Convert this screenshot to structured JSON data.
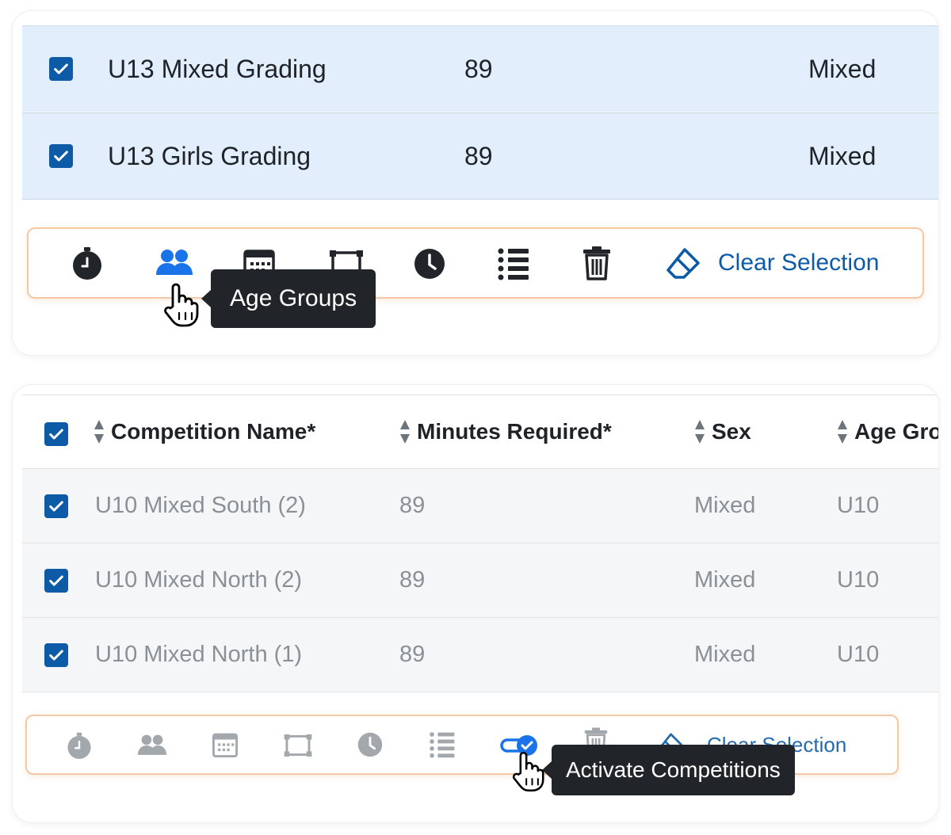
{
  "panel1": {
    "rows": [
      {
        "name": "U13 Mixed Grading",
        "minutes": "89",
        "sex": "Mixed"
      },
      {
        "name": "U13 Girls Grading",
        "minutes": "89",
        "sex": "Mixed"
      }
    ],
    "toolbar": {
      "icons": [
        "stopwatch-icon",
        "age-groups-icon",
        "calendar-icon",
        "court-icon",
        "clock-icon",
        "list-icon",
        "trash-icon"
      ],
      "clear_label": "Clear Selection",
      "tooltip": "Age Groups"
    }
  },
  "panel2": {
    "columns": [
      "Competition Name*",
      "Minutes Required*",
      "Sex",
      "Age Gro"
    ],
    "rows": [
      {
        "name": "U10 Mixed South (2)",
        "minutes": "89",
        "sex": "Mixed",
        "age": "U10"
      },
      {
        "name": "U10 Mixed North (2)",
        "minutes": "89",
        "sex": "Mixed",
        "age": "U10"
      },
      {
        "name": "U10 Mixed North (1)",
        "minutes": "89",
        "sex": "Mixed",
        "age": "U10"
      }
    ],
    "toolbar": {
      "icons": [
        "stopwatch-icon",
        "age-groups-icon",
        "calendar-icon",
        "court-icon",
        "clock-icon",
        "list-icon",
        "activate-toggle-icon",
        "trash-icon"
      ],
      "clear_label": "Clear Selection",
      "tooltip": "Activate Competitions"
    }
  },
  "colors": {
    "primary": "#0d5aa7",
    "link_blue": "#1a73e8",
    "selected_row": "#e2eefc",
    "toolbar_border": "#f2c8a6",
    "tooltip_bg": "#212529",
    "muted_text": "#8b9096"
  }
}
